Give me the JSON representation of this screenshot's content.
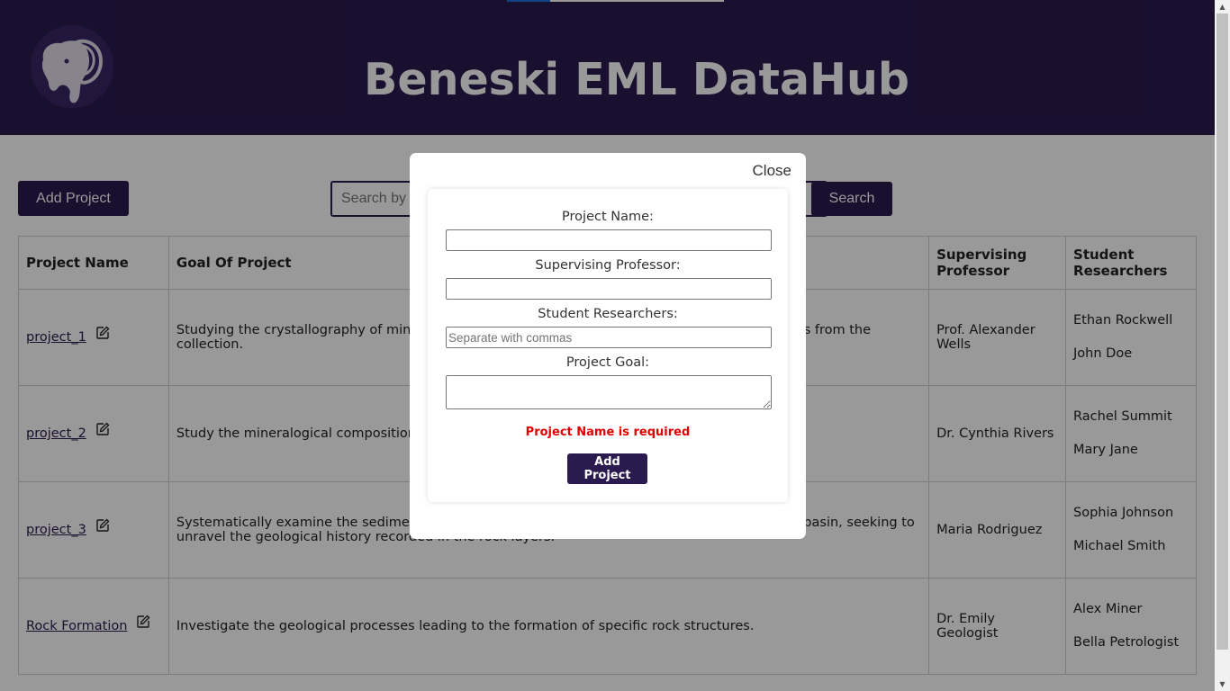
{
  "header": {
    "title": "Beneski EML DataHub",
    "logo_icon": "mammoth-logo-icon"
  },
  "toolbar": {
    "add_project_label": "Add Project",
    "search_placeholder": "Search by name",
    "search_value": "",
    "search_label": "Search"
  },
  "table": {
    "headers": [
      "Project Name",
      "Goal Of Project",
      "Supervising Professor",
      "Student Researchers"
    ],
    "rows": [
      {
        "name": "project_1",
        "goal": "Studying the crystallography of minerals and identifying the key structural properties of samples from the collection.",
        "professor": "Prof. Alexander Wells",
        "students": [
          "Ethan Rockwell",
          "John Doe"
        ]
      },
      {
        "name": "project_2",
        "goal": "Study the mineralogical composition of rock samples collected from the specified region.",
        "professor": "Dr. Cynthia Rivers",
        "students": [
          "Rachel Summit",
          "Mary Jane"
        ]
      },
      {
        "name": "project_3",
        "goal": "Systematically examine the sedimentary rock formations and fossil content of the sedimentary basin, seeking to unravel the geological history recorded in the rock layers.",
        "professor": "Maria Rodriguez",
        "students": [
          "Sophia Johnson",
          "Michael Smith"
        ]
      },
      {
        "name": "Rock Formation",
        "goal": "Investigate the geological processes leading to the formation of specific rock structures.",
        "professor": "Dr. Emily Geologist",
        "students": [
          "Alex Miner",
          "Bella Petrologist"
        ]
      }
    ]
  },
  "modal": {
    "close_label": "Close",
    "fields": {
      "project_name_label": "Project Name:",
      "project_name_value": "",
      "professor_label": "Supervising Professor:",
      "professor_value": "",
      "students_label": "Student Researchers:",
      "students_placeholder": "Separate with commas",
      "goal_label": "Project Goal:",
      "goal_value": ""
    },
    "error": "Project Name is required",
    "submit_label": "Add Project"
  },
  "colors": {
    "brand_purple": "#2b1a4d",
    "error_red": "#e00000",
    "loading_blue": "#1e6fd9"
  }
}
